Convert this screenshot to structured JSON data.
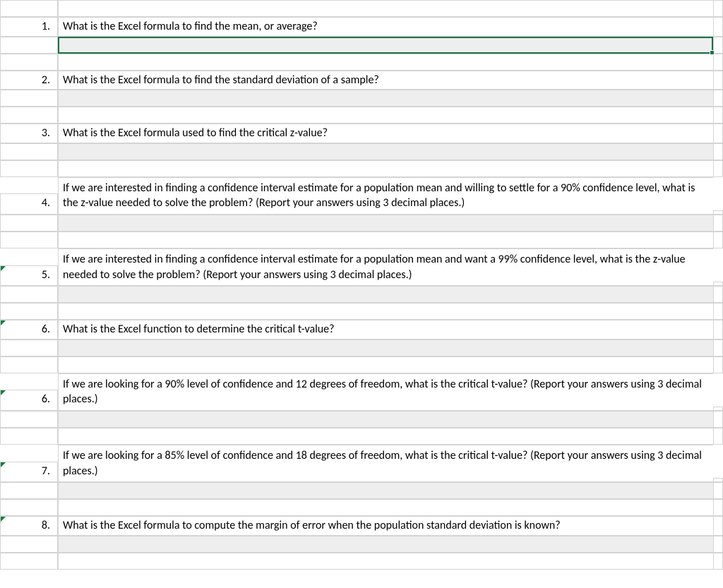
{
  "rows": [
    {
      "num": "1.",
      "question": "What is the Excel formula to find the mean, or average?",
      "tall": false,
      "selectedAnswer": true,
      "marker": false
    },
    {
      "num": "2.",
      "question": "What is the Excel formula to find the standard deviation of a sample?",
      "tall": false,
      "selectedAnswer": false,
      "marker": false
    },
    {
      "num": "3.",
      "question": "What is the Excel formula used to find the critical z-value?",
      "tall": false,
      "selectedAnswer": false,
      "marker": false
    },
    {
      "num": "4.",
      "question": "If we are interested in finding a confidence interval estimate for a population mean and willing to settle for a 90% confidence level, what is the z-value needed to solve the problem? (Report your answers using 3 decimal places.)",
      "tall": true,
      "selectedAnswer": false,
      "marker": false
    },
    {
      "num": "5.",
      "question": "If we are interested in finding a confidence interval estimate for a population mean and want a 99% confidence level, what is the z-value needed to solve the problem? (Report your answers using 3 decimal places.)",
      "tall": true,
      "selectedAnswer": false,
      "marker": true
    },
    {
      "num": "6.",
      "question": "What is the Excel function to determine the critical t-value?",
      "tall": false,
      "selectedAnswer": false,
      "marker": true
    },
    {
      "num": "6.",
      "question": "If we are looking for a 90% level of confidence and 12 degrees of freedom, what is the critical t-value? (Report your answers using 3 decimal places.)",
      "tall": true,
      "selectedAnswer": false,
      "marker": true
    },
    {
      "num": "7.",
      "question": "If we are looking for a 85% level of confidence and 18 degrees of freedom, what is the critical t-value? (Report your answers using 3 decimal places.)",
      "tall": true,
      "selectedAnswer": false,
      "marker": true
    },
    {
      "num": "8.",
      "question": "What is the Excel formula to compute the margin of error when the population standard deviation is known?",
      "tall": false,
      "selectedAnswer": false,
      "marker": true
    }
  ]
}
